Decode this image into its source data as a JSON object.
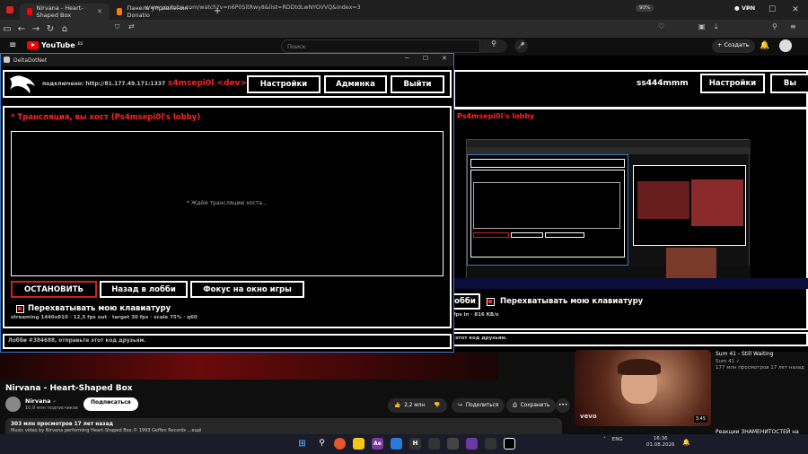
{
  "browser": {
    "tabs": [
      {
        "label": "Nirvana - Heart-Shaped Box",
        "favicon_color": "#ff0000"
      },
      {
        "label": "Панель управления - Donatio",
        "favicon_color": "#ff7a00"
      }
    ],
    "new_tab": "+",
    "url": "www.youtube.com/watch?v=n6P0SitRwy8&list=RDDtdLwNYOVVQ&index=3",
    "zoom": "90%",
    "vpn": "VPN"
  },
  "youtube": {
    "logo": "YouTube",
    "region": "ES",
    "search_placeholder": "Поиск",
    "create": "Создать",
    "video_title": "Nirvana - Heart-Shaped Box",
    "channel": "Nirvana",
    "verified": "✓",
    "subscribers": "10,9 млн подписчиков",
    "subscribe": "Подписаться",
    "likes": "2,2 млн",
    "share": "Поделиться",
    "save": "Сохранить",
    "more": "•••",
    "views": "303 млн просмотров  17 лет назад",
    "desc_line": "Music video by Nirvana performing Heart-Shaped Box.© 1993 Geffen Records  ...ещё",
    "sidebar": [
      {
        "title": "Sum 41 - Still Waiting",
        "meta": "Sum 41 ✓",
        "stats": "177 млн просмотров  17 лет назад",
        "duration": "3:45"
      },
      {
        "title": "Реакции ЗНАМЕНИТОСТЕЙ на",
        "meta": "",
        "stats": "",
        "duration": ""
      }
    ]
  },
  "bg_stream": {
    "user": "ss444mmm",
    "settings": "Настройки",
    "exit": "Вы",
    "stream_title": "Ps4msepi0l's lobby",
    "stop_cut": "обби",
    "capture_kb": "Перехватывать мою клавиатуру",
    "stats": "fps in · 816 KB/s",
    "lobby_msg": "этот код друзьям."
  },
  "app": {
    "window_title": "DeltaDotNet",
    "connected": "подключено: http://81.177.49.171:1337",
    "username": "s4msepi0l  <dev>",
    "settings_btn": "Настройки",
    "admin_btn": "Админка",
    "exit_btn": "Выйти",
    "stream_header": "* Трансляция, вы хост (Ps4msepi0l's lobby)",
    "waiting": "* Ждём трансляцию хоста...",
    "stop_btn": "ОСТАНОВИТЬ",
    "back_btn": "Назад в лобби",
    "focus_btn": "Фокус на окно игры",
    "capture_kb": "Перехватывать мою клавиатуру",
    "capture_checked": true,
    "stream_stats": "streaming 1440x810 · 12,5 fps out · target 30 fps · scale 75% · q60",
    "lobby_code": "Лобби #384688, отправьте этот код друзьям.",
    "accent": "#ff2222"
  },
  "taskbar": {
    "lang": "ENG",
    "time": "16:36",
    "date": "01.08.2026"
  }
}
